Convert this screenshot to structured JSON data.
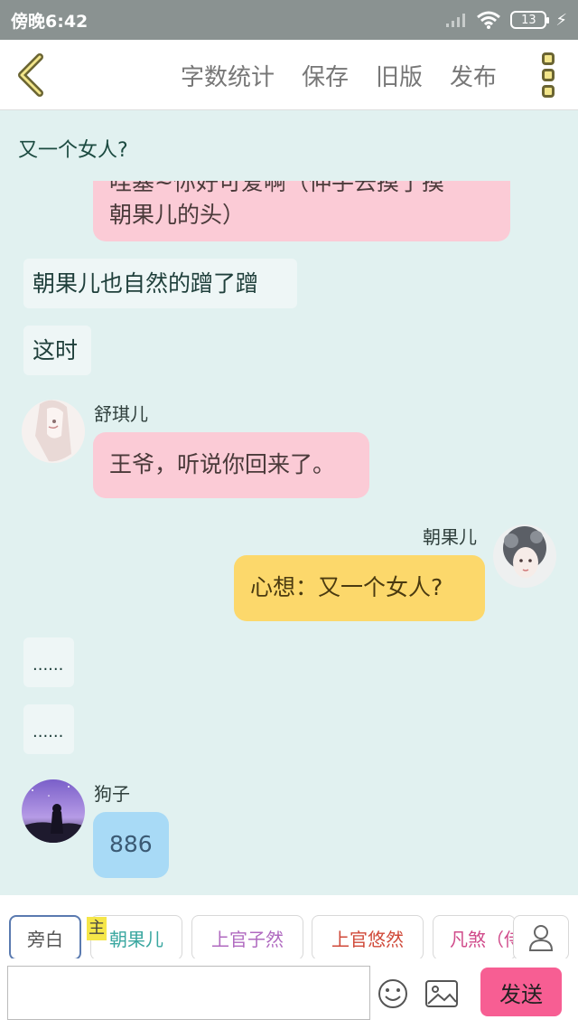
{
  "status_bar": {
    "time": "傍晚6:42",
    "battery": "13"
  },
  "toolbar": {
    "items": [
      "字数统计",
      "保存",
      "旧版",
      "发布"
    ]
  },
  "chat": {
    "title": "又一个女人?",
    "messages": [
      {
        "type": "pink_partial",
        "line1": "哇塞~你好可爱啊（伸手去摸了摸",
        "line2": "朝果儿的头）"
      },
      {
        "type": "narration",
        "text": "朝果儿也自然的蹭了蹭"
      },
      {
        "type": "narration",
        "text": "这时"
      },
      {
        "type": "left",
        "speaker": "舒琪儿",
        "text": "王爷，听说你回来了。"
      },
      {
        "type": "right",
        "speaker": "朝果儿",
        "text": "心想：又一个女人?"
      },
      {
        "type": "narration",
        "text": "......"
      },
      {
        "type": "narration",
        "text": "......"
      },
      {
        "type": "left",
        "speaker": "狗子",
        "text": "886"
      }
    ]
  },
  "role_tabs": {
    "tabs": [
      {
        "label": "旁白",
        "color": "#555555"
      },
      {
        "label": "朝果儿",
        "color": "#3aa7a0"
      },
      {
        "label": "上官子然",
        "color": "#b06ac0"
      },
      {
        "label": "上官悠然",
        "color": "#d04a3a"
      },
      {
        "label": "凡煞（侍",
        "color": "#d04a8a"
      }
    ],
    "main_badge": "主"
  },
  "input": {
    "value": "",
    "send_label": "发送"
  }
}
